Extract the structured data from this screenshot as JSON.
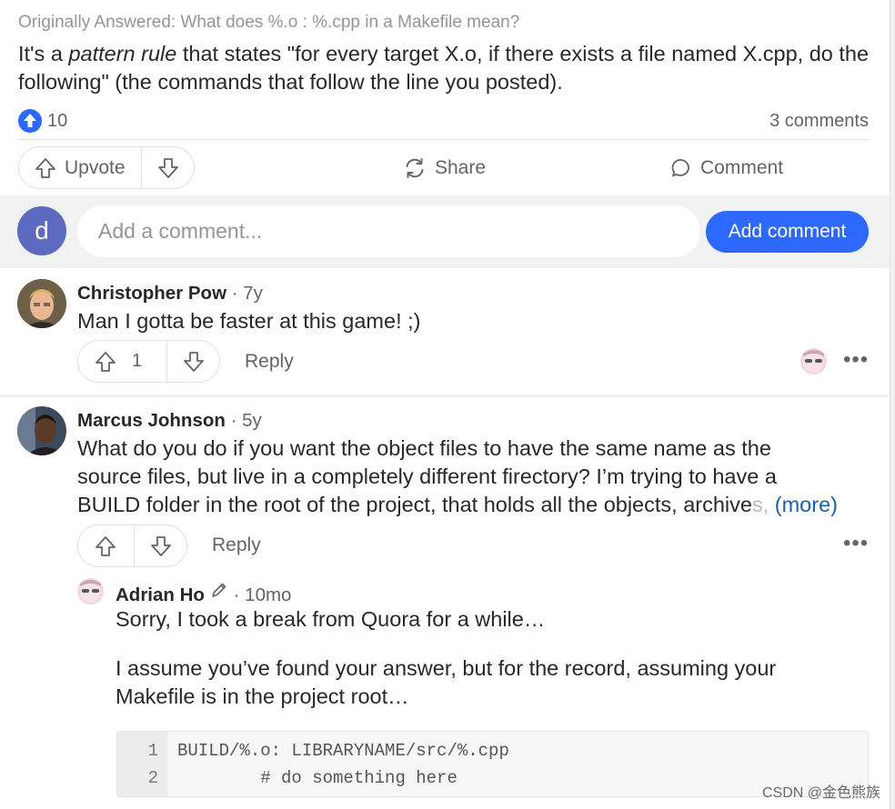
{
  "answer": {
    "originally_answered": "Originally Answered: What does %.o : %.cpp in a Makefile mean?",
    "text_before": "It's a ",
    "text_emphasis": "pattern rule",
    "text_after": " that states \"for every target X.o, if there exists a file named X.cpp, do the following\" (the commands that follow the line you posted).",
    "upvotes": "10",
    "comments_count": "3 comments"
  },
  "actions": {
    "upvote_label": "Upvote",
    "share_label": "Share",
    "comment_label": "Comment"
  },
  "add_comment": {
    "avatar_letter": "d",
    "placeholder": "Add a comment...",
    "button_label": "Add comment"
  },
  "comments": [
    {
      "author": "Christopher Pow",
      "time": " · 7y",
      "text": "Man I gotta be faster at this game! ;)",
      "upvotes": "1",
      "reply_label": "Reply"
    },
    {
      "author": "Marcus Johnson",
      "time": " · 5y",
      "text_line1": "What do you do if you want the object files to have the same name as the",
      "text_line2": "source files, but live in a completely different firectory? I’m trying to have a",
      "text_line3": "BUILD folder in the root of the project, that holds all the objects, archive",
      "text_line3_faded": "s,",
      "more_label": "(more)",
      "reply_label": "Reply"
    }
  ],
  "reply": {
    "author": "Adrian Ho",
    "time": " · 10mo",
    "para1": "Sorry, I took a break from Quora for a while…",
    "para2_line1": "I assume you’ve found your answer, but for the record, assuming your",
    "para2_line2": "Makefile is in the project root…",
    "code_lines": [
      {
        "num": "1",
        "code": "BUILD/%.o: LIBRARYNAME/src/%.cpp"
      },
      {
        "num": "2",
        "code": "        # do something here"
      }
    ]
  },
  "watermark": "CSDN @金色熊族",
  "colors": {
    "accent": "#2e69ff",
    "link": "#195faa",
    "muted": "#636466",
    "divider": "#dee0e1"
  }
}
